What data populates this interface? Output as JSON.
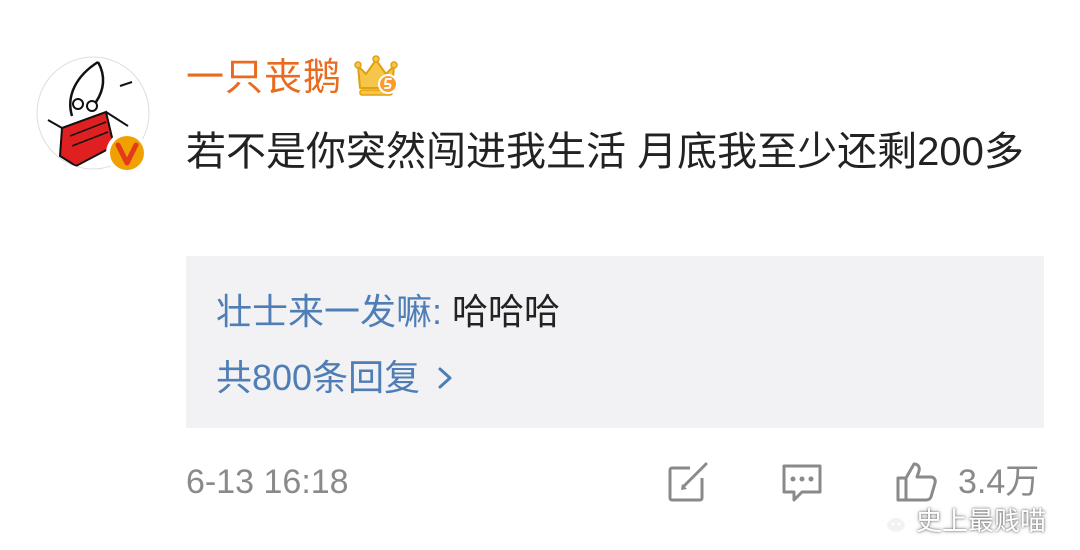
{
  "user": {
    "name": "一只丧鹅"
  },
  "comment": {
    "text": "若不是你突然闯进我生活 月底我至少还剩200多"
  },
  "reply": {
    "author": "壮士来一发嘛",
    "colon": ":",
    "text": " 哈哈哈",
    "count_label": "共800条回复"
  },
  "footer": {
    "timestamp": "6-13 16:18",
    "like_count": "3.4万"
  },
  "watermark": {
    "text": "史上最贱喵"
  },
  "colors": {
    "username": "#e86b1f",
    "link": "#4f7db5",
    "text": "#222222",
    "muted": "#8a8a8a",
    "reply_bg": "#f2f2f4",
    "verified": "#f0a000"
  },
  "icons": {
    "avatar": "avatar-cartoon-goose",
    "verified": "verified-v-icon",
    "member": "crown-member-icon",
    "repost": "repost-icon",
    "comment": "comment-icon",
    "like": "thumbs-up-icon",
    "reply_more": "chevron-right-icon",
    "watermark": "wechat-icon"
  }
}
